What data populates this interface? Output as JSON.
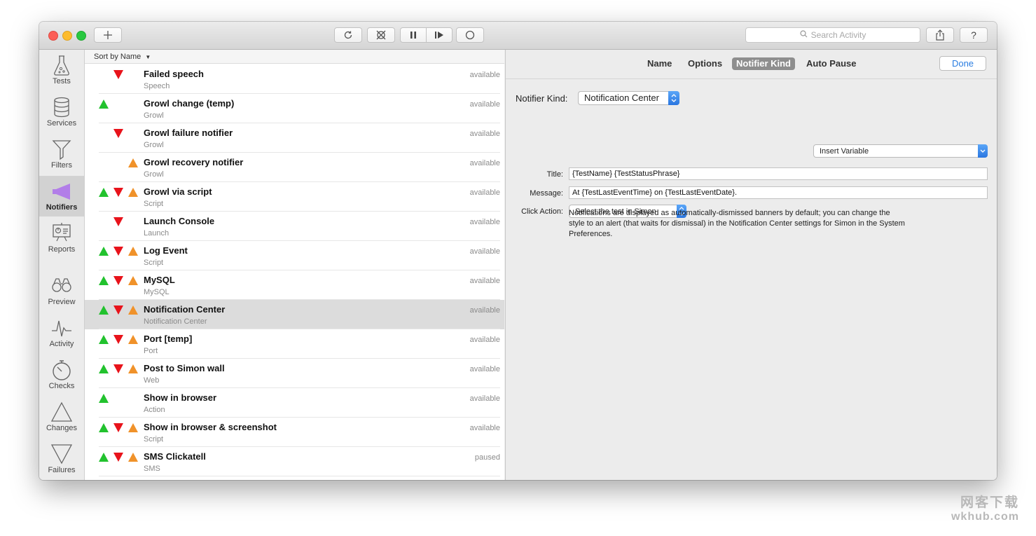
{
  "toolbar": {
    "add_icon": "plus-icon",
    "search_placeholder": "Search Activity"
  },
  "sidebar": {
    "items": [
      {
        "label": "Tests",
        "icon": "flask-icon"
      },
      {
        "label": "Services",
        "icon": "database-icon"
      },
      {
        "label": "Filters",
        "icon": "funnel-icon"
      },
      {
        "label": "Notifiers",
        "icon": "megaphone-icon",
        "active": true
      },
      {
        "label": "Reports",
        "icon": "presentation-icon"
      },
      {
        "label": "Preview",
        "icon": "binoculars-icon"
      },
      {
        "label": "Activity",
        "icon": "pulse-icon"
      },
      {
        "label": "Checks",
        "icon": "stopwatch-icon"
      },
      {
        "label": "Changes",
        "icon": "triangle-up-icon"
      },
      {
        "label": "Failures",
        "icon": "triangle-down-icon"
      }
    ]
  },
  "list": {
    "sort_label": "Sort by Name",
    "rows": [
      {
        "name": "Failed speech",
        "kind": "Speech",
        "status": "available",
        "icons": [
          "",
          "down",
          ""
        ]
      },
      {
        "name": "Growl change (temp)",
        "kind": "Growl",
        "status": "available",
        "icons": [
          "up",
          "",
          ""
        ]
      },
      {
        "name": "Growl failure notifier",
        "kind": "Growl",
        "status": "available",
        "icons": [
          "",
          "down",
          ""
        ]
      },
      {
        "name": "Growl recovery notifier",
        "kind": "Growl",
        "status": "available",
        "icons": [
          "",
          "",
          "warn"
        ]
      },
      {
        "name": "Growl via script",
        "kind": "Script",
        "status": "available",
        "icons": [
          "up",
          "down",
          "warn"
        ]
      },
      {
        "name": "Launch Console",
        "kind": "Launch",
        "status": "available",
        "icons": [
          "",
          "down",
          ""
        ]
      },
      {
        "name": "Log Event",
        "kind": "Script",
        "status": "available",
        "icons": [
          "up",
          "down",
          "warn"
        ]
      },
      {
        "name": "MySQL",
        "kind": "MySQL",
        "status": "available",
        "icons": [
          "up",
          "down",
          "warn"
        ]
      },
      {
        "name": "Notification Center",
        "kind": "Notification Center",
        "status": "available",
        "icons": [
          "up",
          "down",
          "warn"
        ],
        "selected": true
      },
      {
        "name": "Port [temp]",
        "kind": "Port",
        "status": "available",
        "icons": [
          "up",
          "down",
          "warn"
        ]
      },
      {
        "name": "Post to Simon wall",
        "kind": "Web",
        "status": "available",
        "icons": [
          "up",
          "down",
          "warn"
        ]
      },
      {
        "name": "Show in browser",
        "kind": "Action",
        "status": "available",
        "icons": [
          "up",
          "",
          ""
        ]
      },
      {
        "name": "Show in browser & screenshot",
        "kind": "Script",
        "status": "available",
        "icons": [
          "up",
          "down",
          "warn"
        ]
      },
      {
        "name": "SMS Clickatell",
        "kind": "SMS",
        "status": "paused",
        "icons": [
          "up",
          "down",
          "warn"
        ]
      }
    ]
  },
  "detail": {
    "tabs": [
      "Name",
      "Options",
      "Notifier Kind",
      "Auto Pause"
    ],
    "active_tab": "Notifier Kind",
    "done_label": "Done",
    "notifier_kind_label": "Notifier Kind:",
    "notifier_kind_value": "Notification Center",
    "insert_variable_label": "Insert Variable",
    "title_label": "Title:",
    "title_value": "{TestName} {TestStatusPhrase}",
    "message_label": "Message:",
    "message_value": "At {TestLastEventTime} on {TestLastEventDate}.",
    "click_action_label": "Click Action:",
    "click_action_value": "Select the test in Simon",
    "note": "Notifications are displayed as automatically-dismissed banners by default; you can change the style to an alert (that waits for dismissal) in the Notification Center settings for Simon in the System Preferences."
  },
  "colors": {
    "accent": "#2a7de1",
    "up": "#22c22e",
    "down": "#e8131b",
    "warn": "#f0922a",
    "active_notifier_icon": "#b27ee8"
  },
  "watermark": {
    "line1": "网客下载",
    "line2": "wkhub.com"
  }
}
